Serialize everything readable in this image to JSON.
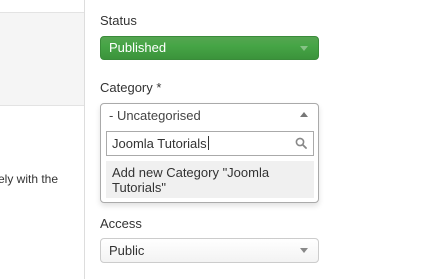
{
  "left": {
    "text": "ely with the"
  },
  "status": {
    "label": "Status",
    "value": "Published",
    "color": "#46a546"
  },
  "category": {
    "label": "Category *",
    "selected": "- Uncategorised",
    "search_value": "Joomla Tutorials",
    "result": "Add new Category \"Joomla Tutorials\""
  },
  "access": {
    "label": "Access",
    "value": "Public"
  },
  "icons": {
    "search": "search-icon",
    "status_arrow": "chevron-down-icon",
    "category_arrow": "chevron-up-icon",
    "access_arrow": "chevron-down-icon"
  }
}
